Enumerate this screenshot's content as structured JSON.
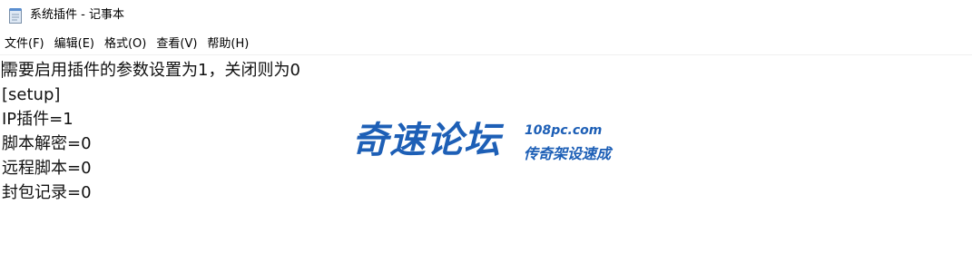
{
  "window": {
    "title": "系统插件 - 记事本",
    "icon": "notepad-icon"
  },
  "menubar": {
    "items": [
      {
        "label": "文件(F)"
      },
      {
        "label": "编辑(E)"
      },
      {
        "label": "格式(O)"
      },
      {
        "label": "查看(V)"
      },
      {
        "label": "帮助(H)"
      }
    ]
  },
  "editor": {
    "lines": [
      "需要启用插件的参数设置为1，关闭则为0",
      "[setup]",
      "IP插件=1",
      "脚本解密=0",
      "远程脚本=0",
      "封包记录=0"
    ]
  },
  "watermark": {
    "main": "奇速论坛",
    "url": "108pc.com",
    "slogan": "传奇架设速成",
    "color": "#1d5fb6"
  }
}
